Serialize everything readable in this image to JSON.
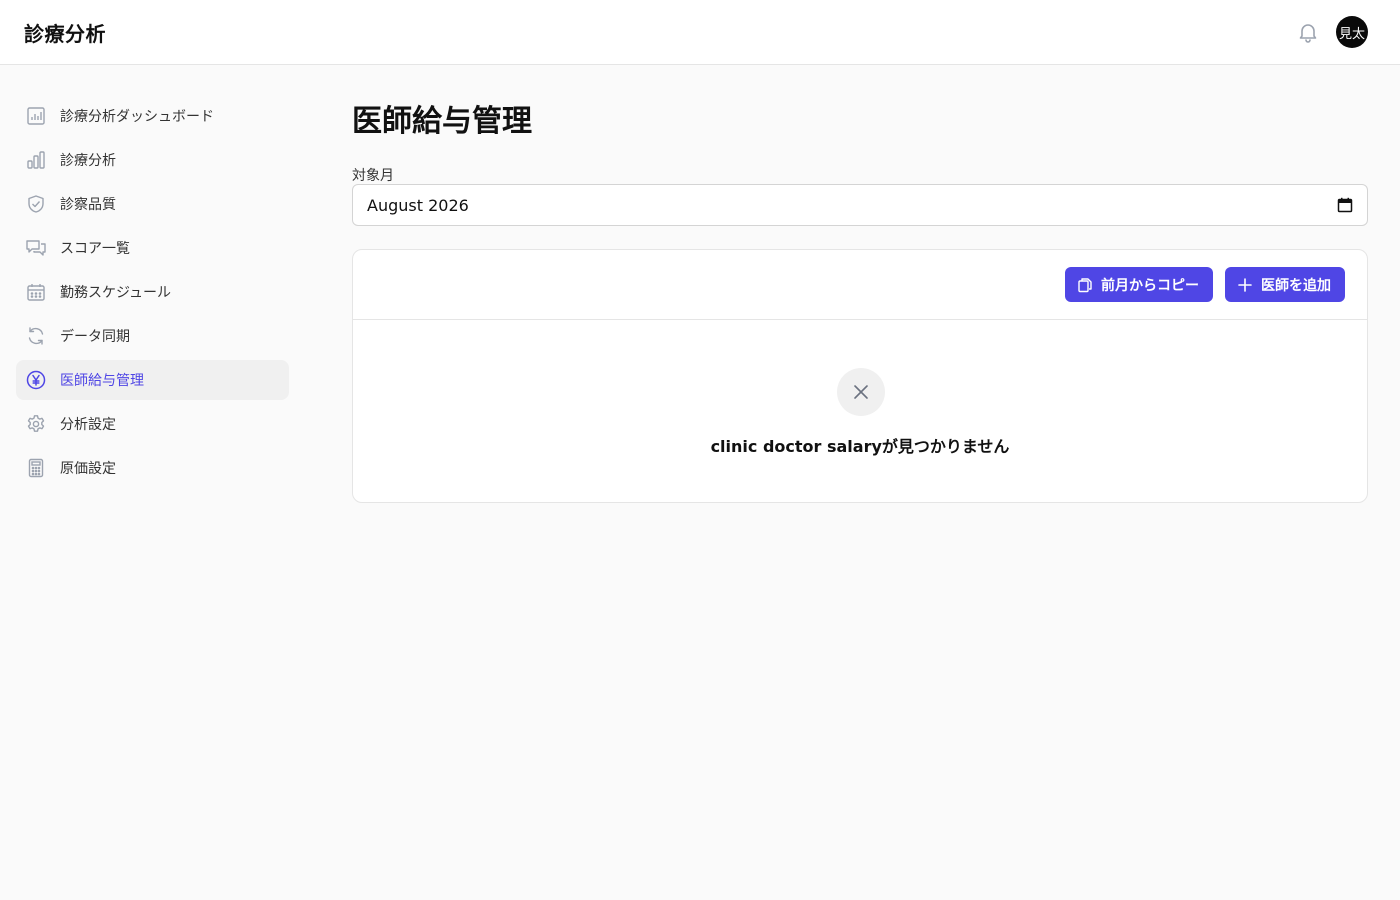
{
  "header": {
    "app_title": "診療分析",
    "avatar_text": "見太"
  },
  "sidebar": {
    "items": [
      {
        "label": "診療分析ダッシュボード",
        "icon": "bar-chart-square-icon"
      },
      {
        "label": "診療分析",
        "icon": "bar-chart-icon"
      },
      {
        "label": "診察品質",
        "icon": "shield-check-icon"
      },
      {
        "label": "スコア一覧",
        "icon": "chat-bubbles-icon"
      },
      {
        "label": "勤務スケジュール",
        "icon": "calendar-icon"
      },
      {
        "label": "データ同期",
        "icon": "refresh-icon"
      },
      {
        "label": "医師給与管理",
        "icon": "yen-circle-icon",
        "active": true
      },
      {
        "label": "分析設定",
        "icon": "gear-icon"
      },
      {
        "label": "原価設定",
        "icon": "calculator-icon"
      }
    ]
  },
  "main": {
    "title": "医師給与管理",
    "month_field": {
      "label": "対象月",
      "value": "August 2026"
    },
    "actions": {
      "copy_label": "前月からコピー",
      "add_label": "医師を追加"
    },
    "empty_state": {
      "message": "clinic doctor salaryが見つかりません"
    }
  },
  "colors": {
    "accent": "#4f46e5",
    "background": "#fafafa",
    "surface": "#ffffff",
    "border": "#e5e5e5"
  }
}
